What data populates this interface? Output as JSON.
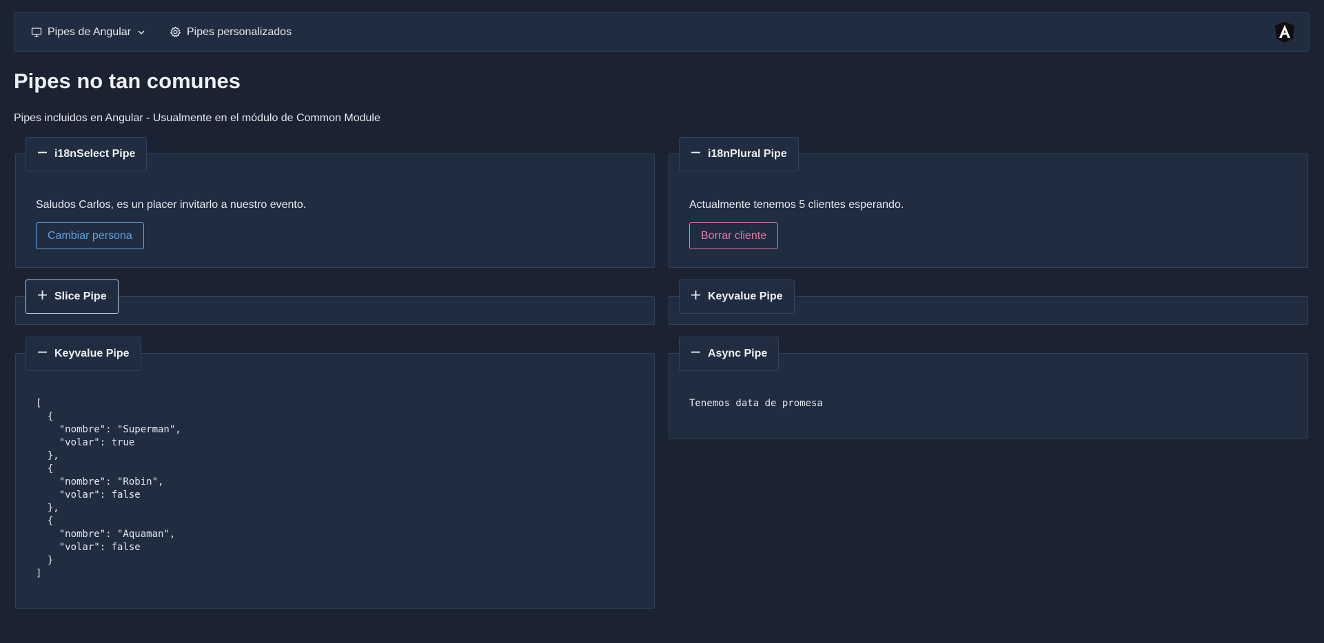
{
  "menubar": {
    "items": [
      {
        "label": "Pipes de Angular",
        "icon": "monitor-icon",
        "has_dropdown": true
      },
      {
        "label": "Pipes personalizados",
        "icon": "gear-icon"
      }
    ],
    "logo": "angular-logo-icon"
  },
  "page": {
    "title": "Pipes no tan comunes",
    "subtitle": "Pipes incluidos en Angular - Usualmente en el módulo de Common Module"
  },
  "panels": {
    "i18nselect": {
      "legend": "i18nSelect Pipe",
      "toggle_icon": "minus-icon",
      "text": "Saludos Carlos, es un placer invitarlo a nuestro evento.",
      "button_label": "Cambiar persona"
    },
    "i18nplural": {
      "legend": "i18nPlural Pipe",
      "toggle_icon": "minus-icon",
      "text": "Actualmente tenemos 5 clientes esperando.",
      "button_label": "Borrar cliente"
    },
    "slice": {
      "legend": "Slice Pipe",
      "toggle_icon": "plus-icon"
    },
    "keyvalue_collapsed": {
      "legend": "Keyvalue Pipe",
      "toggle_icon": "plus-icon"
    },
    "keyvalue": {
      "legend": "Keyvalue Pipe",
      "toggle_icon": "minus-icon",
      "json": "[\n  {\n    \"nombre\": \"Superman\",\n    \"volar\": true\n  },\n  {\n    \"nombre\": \"Robin\",\n    \"volar\": false\n  },\n  {\n    \"nombre\": \"Aquaman\",\n    \"volar\": false\n  }\n]"
    },
    "async": {
      "legend": "Async Pipe",
      "toggle_icon": "minus-icon",
      "text": "Tenemos data de promesa"
    }
  },
  "colors": {
    "background": "#1b2232",
    "panel": "#202c40",
    "border": "#324157",
    "primary_button": "#5ea3e0",
    "danger_button": "#e57ba3"
  }
}
